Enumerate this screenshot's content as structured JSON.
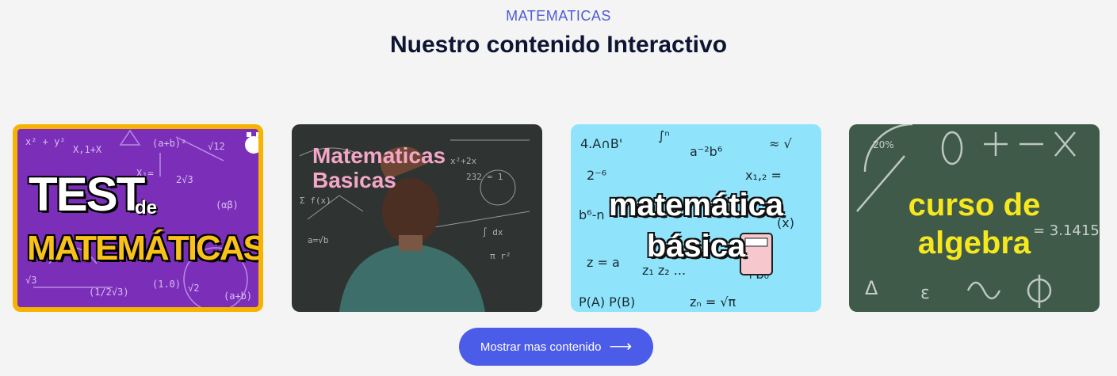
{
  "section": {
    "eyebrow": "MATEMATICAS",
    "title": "Nuestro contenido Interactivo"
  },
  "cards": [
    {
      "title_line1": "TEST",
      "title_word": "de",
      "title_line2": "MATEMÁTICAS"
    },
    {
      "title_line1": "Matematicas",
      "title_line2": "Basicas"
    },
    {
      "title_line1": "matemática",
      "title_line2": "básica"
    },
    {
      "title_line1": "curso de",
      "title_line2": "algebra"
    }
  ],
  "button": {
    "label": "Mostrar mas contenido",
    "icon": "arrow-right-icon"
  },
  "colors": {
    "accent": "#4b5ce8",
    "eyebrow": "#4f5bd5",
    "heading": "#0d1533"
  }
}
